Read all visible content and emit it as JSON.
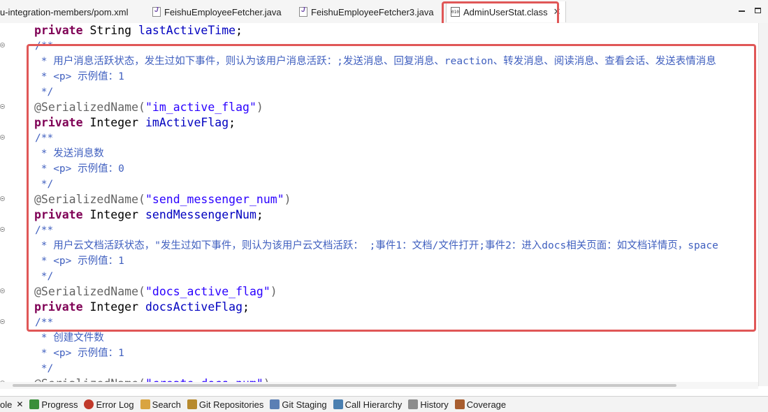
{
  "editor_tabs": [
    {
      "label": "u-integration-members/pom.xml",
      "icon": "xml-file-icon",
      "active": false
    },
    {
      "label": "FeishuEmployeeFetcher.java",
      "icon": "java-file-icon",
      "active": false
    },
    {
      "label": "FeishuEmployeeFetcher3.java",
      "icon": "java-file-icon",
      "active": false
    },
    {
      "label": "AdminUserStat.class",
      "icon": "class-file-icon",
      "active": true,
      "close": "✕"
    }
  ],
  "code": {
    "l1": {
      "kw": "private",
      "type": " String ",
      "field": "lastActiveTime",
      "end": ";"
    },
    "l2": "/**",
    "l3": " * 用户消息活跃状态，发生过如下事件，则认为该用户消息活跃：;发送消息、回复消息、reaction、转发消息、阅读消息、查看会话、发送表情消息",
    "l4": " * <p> 示例值：1",
    "l5": " */",
    "l6": {
      "ann": "@SerializedName(",
      "str": "\"im_active_flag\"",
      "end": ")"
    },
    "l7": {
      "kw": "private",
      "type": " Integer ",
      "field": "imActiveFlag",
      "end": ";"
    },
    "l8": "/**",
    "l9": " * 发送消息数",
    "l10": " * <p> 示例值：0",
    "l11": " */",
    "l12": {
      "ann": "@SerializedName(",
      "str": "\"send_messenger_num\"",
      "end": ")"
    },
    "l13": {
      "kw": "private",
      "type": " Integer ",
      "field": "sendMessengerNum",
      "end": ";"
    },
    "l14": "/**",
    "l15": " * 用户云文档活跃状态，\"发生过如下事件，则认为该用户云文档活跃： ;事件1：文档/文件打开;事件2：进入docs相关页面：如文档详情页，space",
    "l16": " * <p> 示例值：1",
    "l17": " */",
    "l18": {
      "ann": "@SerializedName(",
      "str": "\"docs_active_flag\"",
      "end": ")"
    },
    "l19": {
      "kw": "private",
      "type": " Integer ",
      "field": "docsActiveFlag",
      "end": ";"
    },
    "l20": "/**",
    "l21": " * 创建文件数",
    "l22": " * <p> 示例值：1",
    "l23": " */",
    "l24": {
      "ann": "@SerializedName(",
      "str": "\"create_docs_num\"",
      "end": ")"
    }
  },
  "bottom_tabs": [
    {
      "label": "ole",
      "icon": "console-icon",
      "close": "✕"
    },
    {
      "label": "Progress",
      "icon": "progress-icon"
    },
    {
      "label": "Error Log",
      "icon": "error-log-icon"
    },
    {
      "label": "Search",
      "icon": "search-icon"
    },
    {
      "label": "Git Repositories",
      "icon": "git-repositories-icon"
    },
    {
      "label": "Git Staging",
      "icon": "git-staging-icon"
    },
    {
      "label": "Call Hierarchy",
      "icon": "call-hierarchy-icon"
    },
    {
      "label": "History",
      "icon": "history-icon"
    },
    {
      "label": "Coverage",
      "icon": "coverage-icon"
    }
  ],
  "colors": {
    "highlight": "#e05757",
    "keyword": "#7f0055",
    "comment": "#3f5fbf",
    "string": "#2a00ff",
    "field": "#0000c0"
  }
}
